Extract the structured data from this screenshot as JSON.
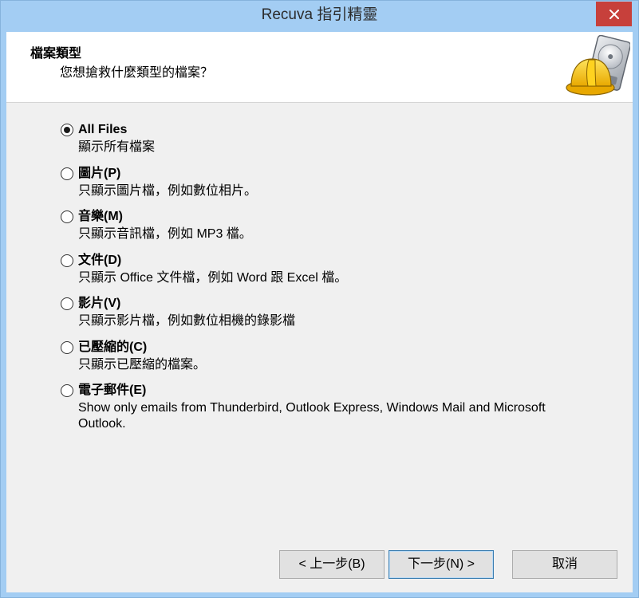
{
  "window": {
    "title": "Recuva 指引精靈"
  },
  "header": {
    "title": "檔案類型",
    "subtitle": "您想搶救什麼類型的檔案？"
  },
  "file_types": {
    "options": [
      {
        "label": "All Files",
        "description": "顯示所有檔案",
        "selected": true
      },
      {
        "label": "圖片(P)",
        "description": "只顯示圖片檔，例如數位相片。",
        "selected": false
      },
      {
        "label": "音樂(M)",
        "description": "只顯示音訊檔，例如 MP3 檔。",
        "selected": false
      },
      {
        "label": "文件(D)",
        "description": "只顯示 Office 文件檔，例如 Word 跟 Excel 檔。",
        "selected": false
      },
      {
        "label": "影片(V)",
        "description": "只顯示影片檔，例如數位相機的錄影檔",
        "selected": false
      },
      {
        "label": "已壓縮的(C)",
        "description": "只顯示已壓縮的檔案。",
        "selected": false
      },
      {
        "label": "電子郵件(E)",
        "description": "Show only emails from Thunderbird, Outlook Express, Windows Mail and Microsoft Outlook.",
        "selected": false
      }
    ]
  },
  "buttons": {
    "back": {
      "label": "< 上一步(B)",
      "focused": false
    },
    "next": {
      "label": "下一步(N) >",
      "focused": true
    },
    "cancel": {
      "label": "取消",
      "focused": false
    }
  },
  "icons": {
    "close": "close-icon",
    "logo": "recuva-hardhat-drive-icon"
  },
  "colors": {
    "frame": "#a3cdf3",
    "close_button": "#c7403b",
    "header_background": "#ffffff",
    "body_background": "#f0f0f0",
    "focus_border": "#3c7fb1"
  }
}
